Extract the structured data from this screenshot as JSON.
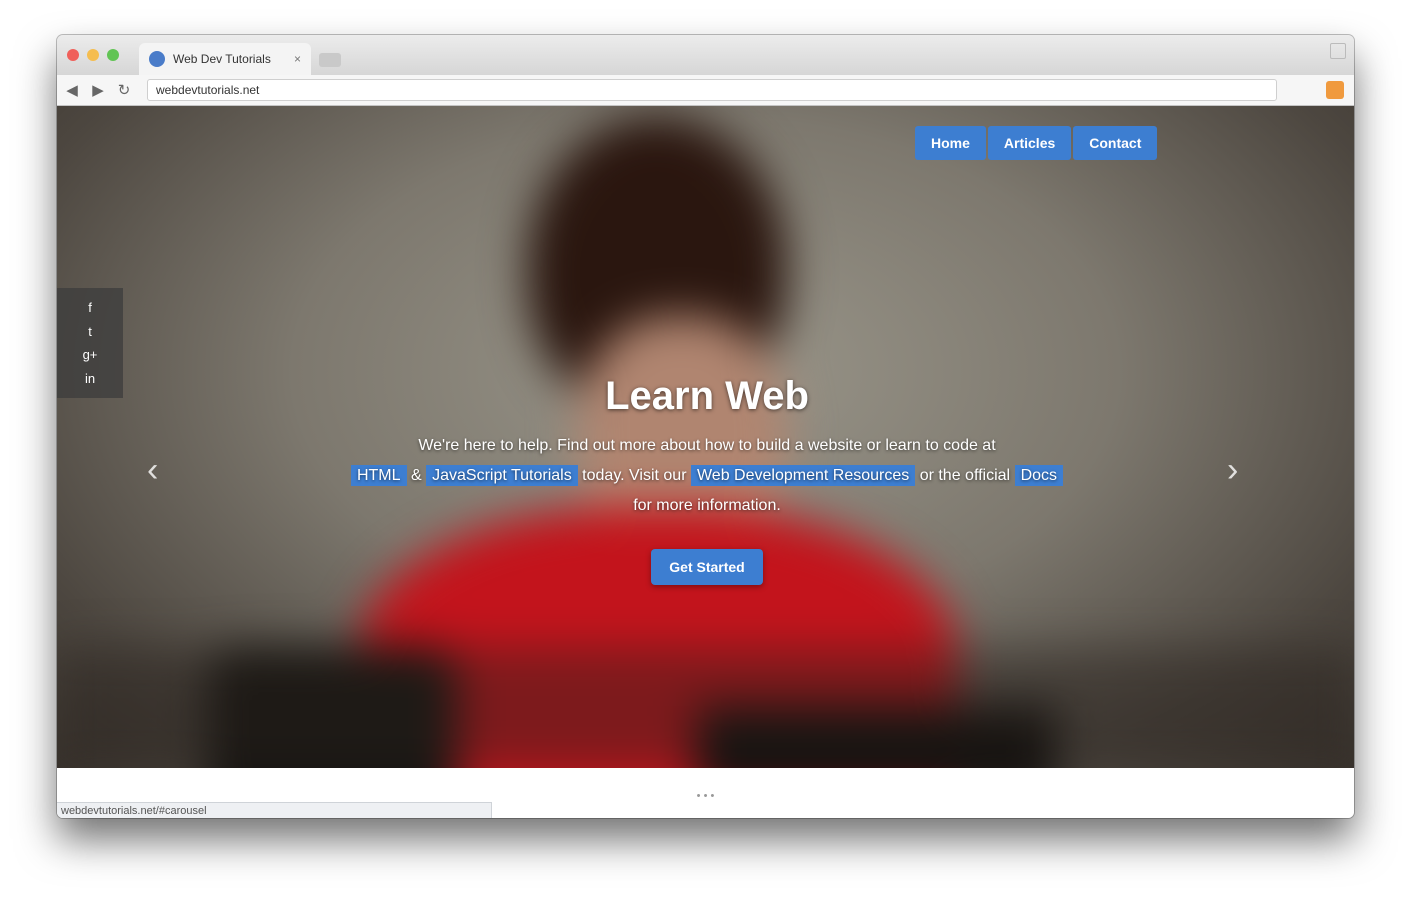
{
  "browser": {
    "tab_title": "Web Dev Tutorials",
    "tab_close": "×",
    "address": "webdevtutorials.net",
    "back": "◀",
    "forward": "▶",
    "reload": "↻",
    "status_url": "webdevtutorials.net/#carousel"
  },
  "page": {
    "nav": [
      "Home",
      "Articles",
      "Contact"
    ],
    "social": [
      "f",
      "t",
      "g+",
      "in"
    ],
    "hero": {
      "heading": "Learn Web",
      "line1": "We're here to help. Find out more about how to build a website or learn to code at",
      "tag_a": "HTML",
      "word_a": "&",
      "tag_b": "JavaScript Tutorials",
      "word_b": "today. Visit our",
      "tag_c": "Web Development Resources",
      "word_c": "or the official",
      "tag_d": "Docs",
      "line3": "for more information.",
      "cta": "Get Started"
    },
    "carousel": {
      "prev": "‹",
      "next": "›",
      "indicators": "• • •"
    }
  },
  "colors": {
    "accent": "#3d7ed1",
    "shirt": "#c3141c"
  }
}
